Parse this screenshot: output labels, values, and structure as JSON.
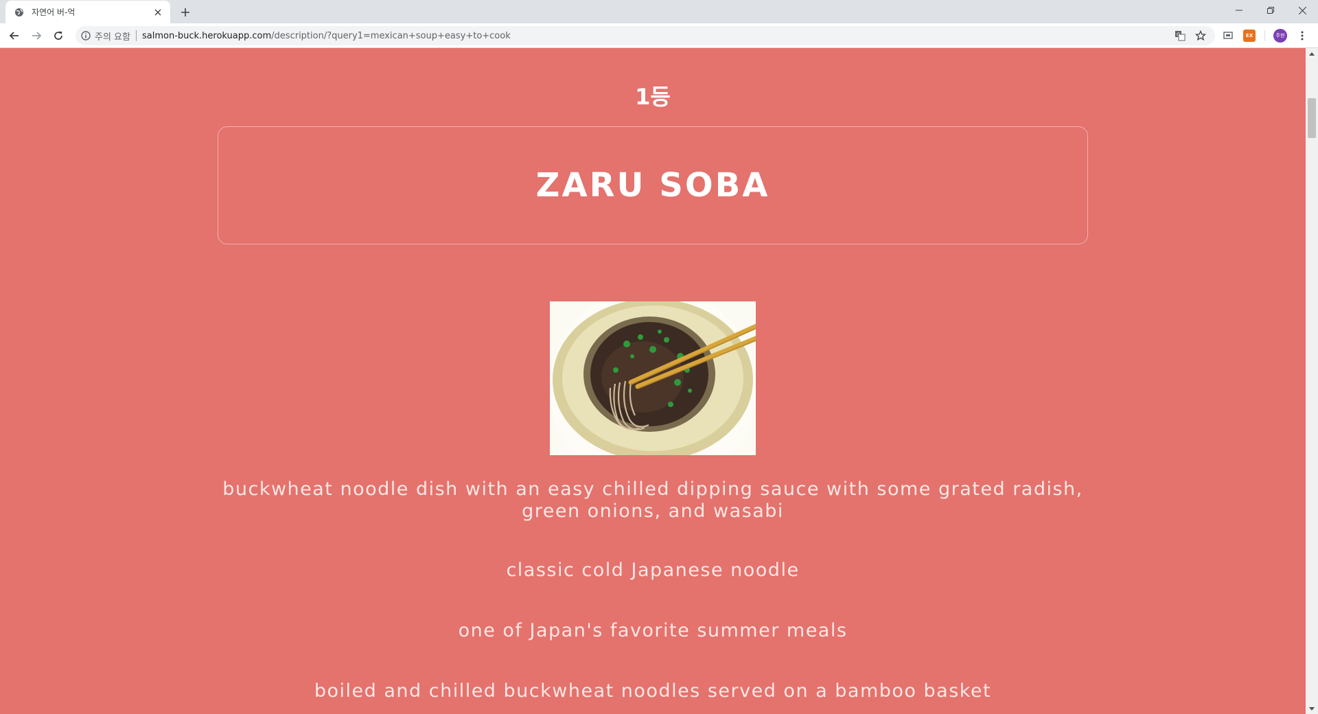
{
  "browser": {
    "tab_title": "자연어 버-억",
    "url_security": "주의 요함",
    "url_host": "salmon-buck.herokuapp.com",
    "url_path": "/description/?query1=mexican+soup+easy+to+cook",
    "profile_initials": "주현",
    "extension_label": "EX"
  },
  "page": {
    "rank": "1등",
    "dish_title": "ZARU SOBA",
    "descriptions": [
      "buckwheat noodle dish with an easy chilled dipping sauce with some grated radish, green onions, and wasabi",
      "classic cold Japanese noodle",
      "one of Japan's favorite summer meals",
      "boiled and chilled buckwheat noodles served on a bamboo basket"
    ]
  },
  "colors": {
    "background": "#e4726d",
    "title_text": "#ffffff",
    "description_text": "#fde7e4"
  },
  "icons": {
    "tab_favicon": "globe-icon",
    "tab_close": "close-icon",
    "new_tab": "plus-icon",
    "back": "back-arrow-icon",
    "forward": "forward-arrow-icon",
    "reload": "reload-icon",
    "security": "info-icon",
    "translate": "translate-icon",
    "bookmark": "star-icon",
    "menu": "kebab-menu-icon"
  }
}
